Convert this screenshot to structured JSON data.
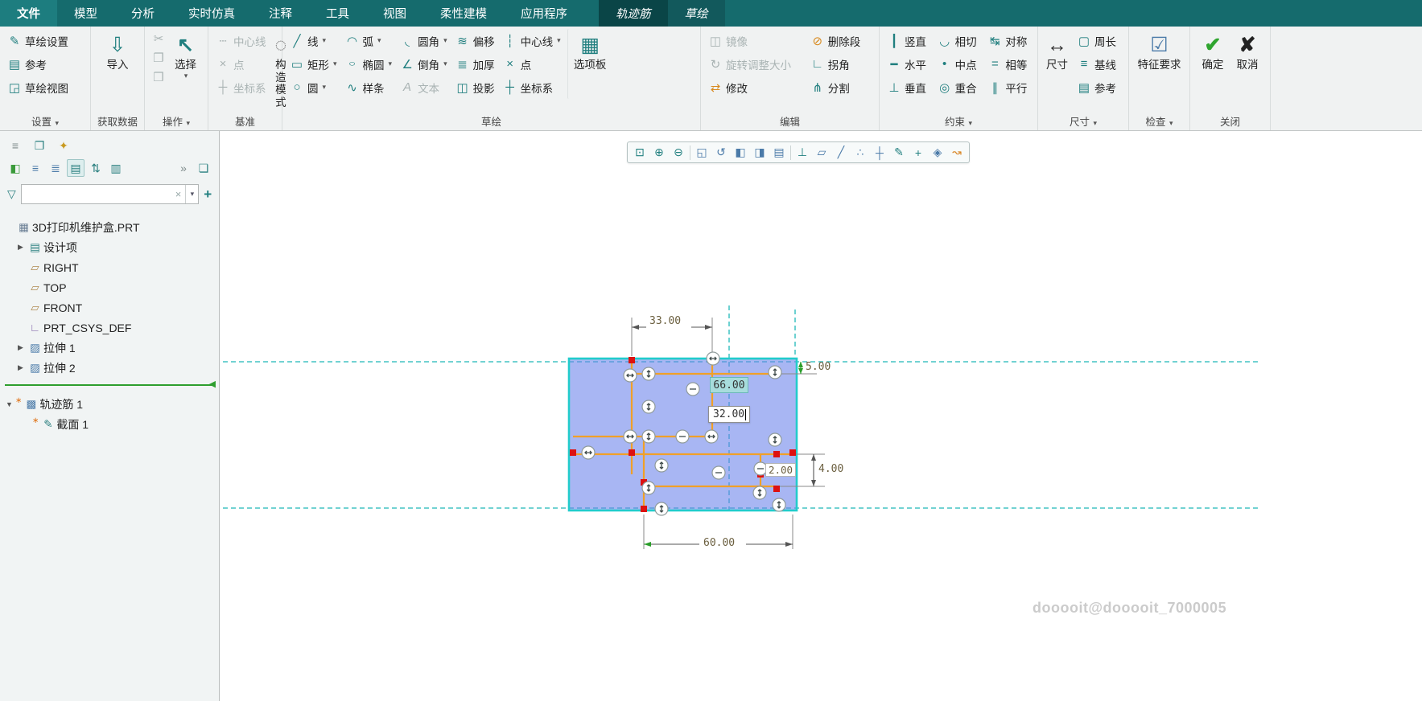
{
  "colors": {
    "menubar_bg": "#156b6d",
    "contextual_tab_bg": "#0a4547",
    "selection_cyan": "#22cccc",
    "sketch_fill": "#697ee8",
    "sketch_line_orange": "#f0a028",
    "constraint_marker_red": "#dd1111",
    "dimension_text": "#6b5f3f",
    "confirm_green": "#2fa52f"
  },
  "icons": {
    "chevron_down": "▾",
    "expand_closed": "▶",
    "expand_open": "▼",
    "overflow": "»",
    "clear_x": "×",
    "plus": "+",
    "filter": "▽",
    "sketch_setup": "✎",
    "references": "▤",
    "sketch_view": "◲",
    "import_arrow": "⇩",
    "cut": "✂",
    "copy": "❐",
    "paste": "❒",
    "select_cursor": "↖",
    "centerline_datum": "┄",
    "point_datum": "×",
    "csys_datum": "┼",
    "construction": "◌",
    "line": "╱",
    "arc": "◠",
    "fillet": "◟",
    "offset": "≋",
    "centerline": "┆",
    "rectangle": "▭",
    "ellipse": "○",
    "chamfer": "∠",
    "thicken": "≣",
    "point": "×",
    "circle": "○",
    "spline": "∿",
    "text": "A",
    "project": "◫",
    "csys": "┼",
    "palette": "▦",
    "mirror": "◫",
    "rotate_resize": "↻",
    "modify": "⇄",
    "delete_segment": "⊘",
    "corner": "∟",
    "divide": "⋔",
    "vertical": "┃",
    "tangent": "◡",
    "symmetric": "↹",
    "horizontal": "━",
    "midpoint": "•",
    "equal": "=",
    "perpendicular": "⊥",
    "coincident": "◎",
    "parallel": "∥",
    "dimension": "↔",
    "perimeter": "▢",
    "baseline": "≡",
    "ref_dim": "▤",
    "feature_req": "☑",
    "ok_check": "✔",
    "cancel_x": "✘",
    "model_tree": "≡",
    "documents": "❐",
    "favorites": "✦",
    "show_panel": "◧",
    "list_flat": "≡",
    "list_detail": "≣",
    "list_columns": "▤",
    "sort": "⇅",
    "columns": "▥",
    "doc": "❏",
    "part": "▦",
    "design_items": "▤",
    "plane": "▱",
    "csys_tree": "∟",
    "extrude": "▨",
    "rib": "▩",
    "section": "✎",
    "asterisk": "∗",
    "insert_arrow": "◀",
    "zoom_region": "⊡",
    "zoom_in": "⊕",
    "zoom_out": "⊖",
    "refit": "◱",
    "repaint": "↺",
    "style_shaded": "◧",
    "style_hidden": "◨",
    "style_wire": "▤",
    "view_normal": "⊥",
    "datum_planes": "▱",
    "datum_axes": "╱",
    "datum_points": "∴",
    "datum_csys": "┼",
    "annotations": "✎",
    "spin_center": "+",
    "orient_3d": "◈",
    "links": "↝"
  },
  "menubar": {
    "tabs": [
      {
        "label": "文件"
      },
      {
        "label": "模型"
      },
      {
        "label": "分析"
      },
      {
        "label": "实时仿真"
      },
      {
        "label": "注释"
      },
      {
        "label": "工具"
      },
      {
        "label": "视图"
      },
      {
        "label": "柔性建模"
      },
      {
        "label": "应用程序"
      },
      {
        "label": "轨迹筋"
      },
      {
        "label": "草绘"
      }
    ]
  },
  "ribbon": {
    "settings": {
      "label": "设置",
      "items": [
        "草绘设置",
        "参考",
        "草绘视图"
      ]
    },
    "get_data": {
      "label": "获取数据",
      "import_btn": "导入"
    },
    "operations": {
      "label": "操作",
      "select_btn": "选择"
    },
    "datum": {
      "label": "基准",
      "centerline": "中心线",
      "point": "点",
      "csys": "坐标系",
      "construction": "构造模式"
    },
    "sketch": {
      "label": "草绘",
      "row1": [
        "线",
        "弧",
        "圆角",
        "偏移",
        "中心线"
      ],
      "row2": [
        "矩形",
        "椭圆",
        "倒角",
        "加厚",
        "点"
      ],
      "row3": [
        "圆",
        "样条",
        "文本",
        "投影",
        "坐标系"
      ],
      "palette": "选项板"
    },
    "edit": {
      "label": "编辑",
      "col1": [
        "镜像",
        "旋转调整大小",
        "修改"
      ],
      "col2": [
        "删除段",
        "拐角",
        "分割"
      ]
    },
    "constrain": {
      "label": "约束",
      "col1": [
        "竖直",
        "水平",
        "垂直"
      ],
      "col2": [
        "相切",
        "中点",
        "重合"
      ],
      "col3": [
        "对称",
        "相等",
        "平行"
      ]
    },
    "dimension": {
      "label": "尺寸",
      "main": "尺寸",
      "items": [
        "周长",
        "基线",
        "参考"
      ]
    },
    "inspect": {
      "label": "检查",
      "main": "特征要求"
    },
    "close": {
      "label": "关闭",
      "ok": "确定",
      "cancel": "取消"
    }
  },
  "tree": {
    "filter_value": "",
    "items": [
      {
        "label": "3D打印机维护盒.PRT"
      },
      {
        "label": "设计项"
      },
      {
        "label": "RIGHT"
      },
      {
        "label": "TOP"
      },
      {
        "label": "FRONT"
      },
      {
        "label": "PRT_CSYS_DEF"
      },
      {
        "label": "拉伸 1"
      },
      {
        "label": "拉伸 2"
      },
      {
        "label": "轨迹筋 1"
      },
      {
        "label": "截面 1"
      }
    ]
  },
  "canvas": {
    "dims": {
      "d33": "33.00",
      "d5": "5.00",
      "d66": "66.00",
      "d32": "32.00",
      "d2": "2.00",
      "d4": "4.00",
      "d60": "60.00"
    },
    "watermark": "dooooit@dooooit_7000005"
  }
}
